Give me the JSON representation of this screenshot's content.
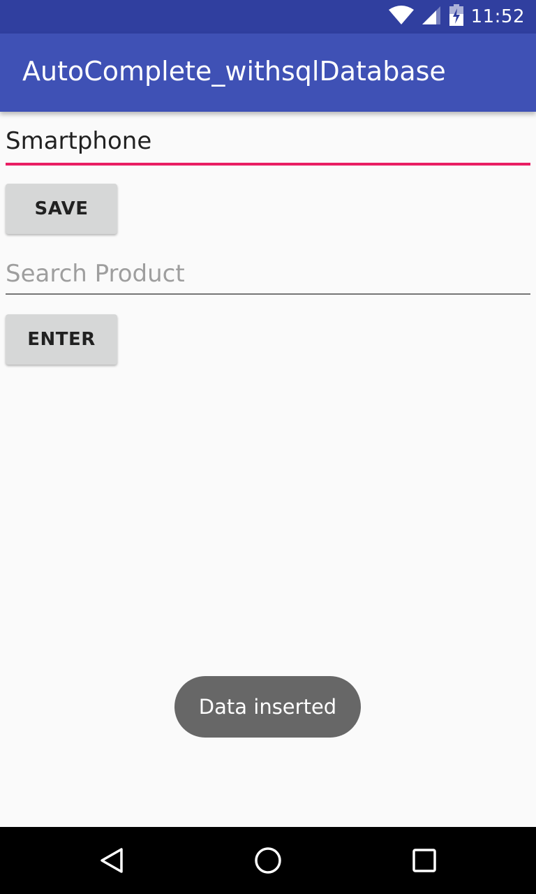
{
  "status_bar": {
    "time": "11:52",
    "icons": [
      "wifi-icon",
      "cell-signal-icon",
      "battery-charging-icon"
    ]
  },
  "app_bar": {
    "title": "AutoComplete_withsqlDatabase"
  },
  "form": {
    "product_input_value": "Smartphone",
    "save_label": "SAVE",
    "search_placeholder": "Search Product",
    "enter_label": "ENTER"
  },
  "toast": {
    "message": "Data inserted"
  },
  "nav_bar": {
    "icons": [
      "back-icon",
      "home-icon",
      "recents-icon"
    ]
  },
  "colors": {
    "status_bar": "#303f9f",
    "app_bar": "#3f51b5",
    "accent": "#e91e63",
    "button": "#d6d7d7",
    "toast": "#676767"
  }
}
